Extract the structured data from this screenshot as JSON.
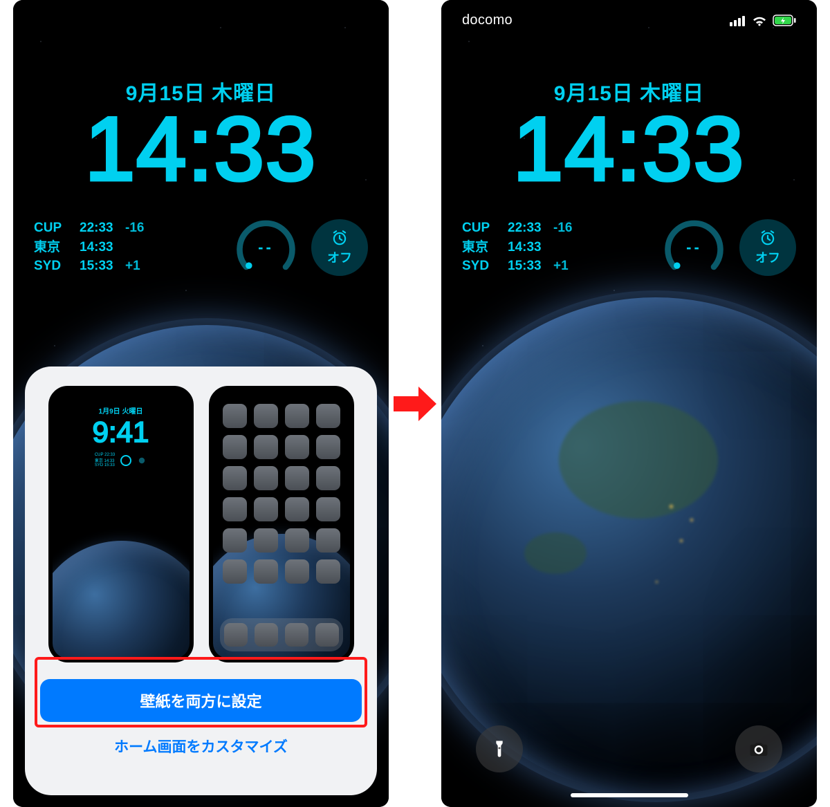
{
  "date_line": "9月15日 木曜日",
  "big_time": "14:33",
  "world_clock": [
    {
      "city": "CUP",
      "time": "22:33",
      "offset": "-16"
    },
    {
      "city": "東京",
      "time": "14:33",
      "offset": ""
    },
    {
      "city": "SYD",
      "time": "15:33",
      "offset": "+1"
    }
  ],
  "gauge_value": "--",
  "alarm_label": "オフ",
  "statusbar": {
    "carrier": "docomo"
  },
  "sheet": {
    "preview_mini_date": "1月9日 火曜日",
    "preview_mini_time": "9:41",
    "set_both_label": "壁紙を両方に設定",
    "customize_home_label": "ホーム画面をカスタマイズ"
  }
}
